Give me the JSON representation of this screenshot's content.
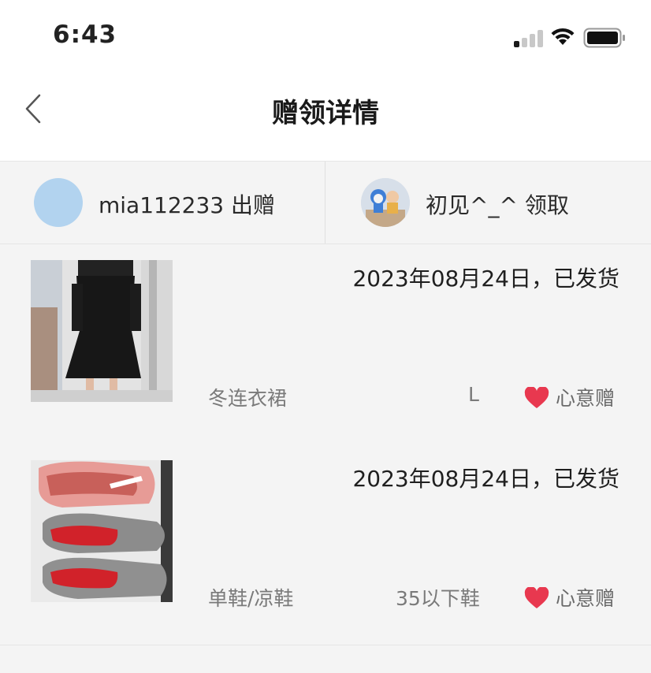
{
  "status": {
    "time": "6:43"
  },
  "nav": {
    "title": "赠领详情"
  },
  "parties": {
    "giver": "mia112233 出赠",
    "receiver": "初见^_^ 领取"
  },
  "items": [
    {
      "date": "2023年08月24日，已发货",
      "category": "冬连衣裙",
      "size": "L",
      "gift_type": "心意赠"
    },
    {
      "date": "2023年08月24日，已发货",
      "category": "单鞋/凉鞋",
      "size": "35以下鞋",
      "gift_type": "心意赠"
    }
  ],
  "colors": {
    "heart": "#e8384f",
    "avatar_placeholder": "#b2d3ef"
  }
}
